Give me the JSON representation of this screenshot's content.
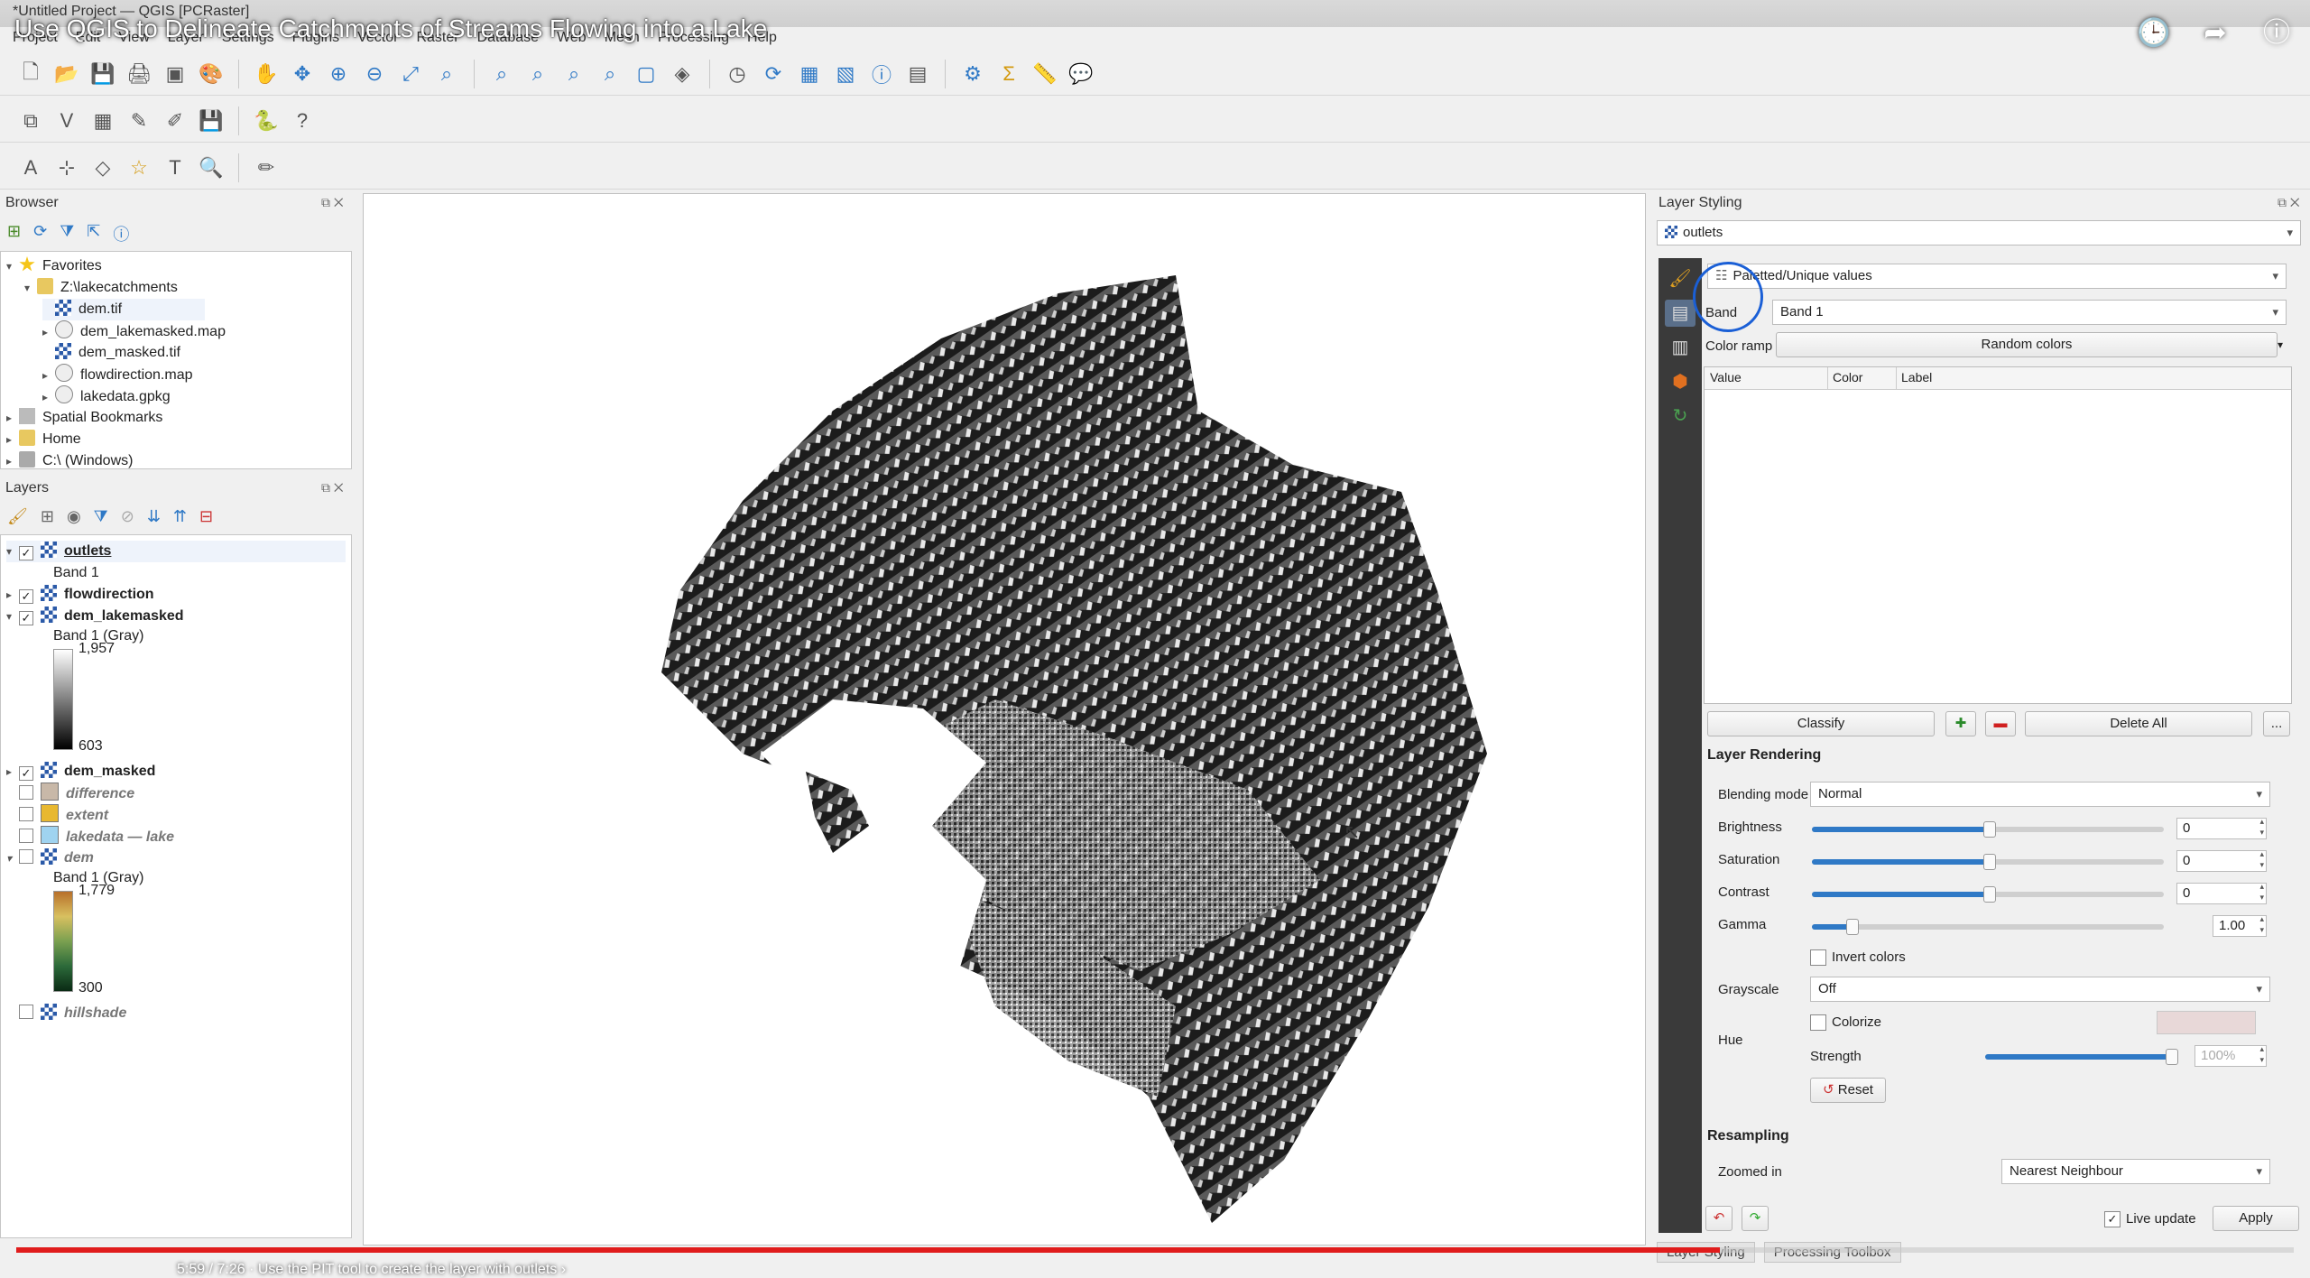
{
  "window": {
    "title": "*Untitled Project — QGIS [PCRaster]",
    "video_title": "Use QGIS to Delineate Catchments of Streams Flowing into a Lake"
  },
  "menu": [
    "Project",
    "Edit",
    "View",
    "Layer",
    "Settings",
    "Plugins",
    "Vector",
    "Raster",
    "Database",
    "Web",
    "Mesh",
    "Processing",
    "Help"
  ],
  "toolbar_icons": {
    "row1": [
      "new-project-icon",
      "open-project-icon",
      "save-project-icon",
      "print-layout-icon",
      "layout-manager-icon",
      "style-manager-icon",
      "pan-icon",
      "pan-to-selection-icon",
      "zoom-in-icon",
      "zoom-out-icon",
      "zoom-full-icon",
      "zoom-selection-icon",
      "zoom-layer-icon",
      "zoom-native-icon",
      "zoom-last-icon",
      "zoom-next-icon",
      "new-map-view-icon",
      "new-3d-view-icon",
      "temporal-icon",
      "refresh-icon",
      "select-icon",
      "deselect-icon",
      "identify-icon",
      "attribute-table-icon",
      "toolbox-gear-icon",
      "sum-icon",
      "measure-icon",
      "annotation-icon"
    ],
    "row2": [
      "add-layer-icon",
      "add-vector-icon",
      "add-raster-icon",
      "digitize-icon",
      "edit-icon",
      "save-edits-icon",
      "python-icon",
      "help-icon"
    ],
    "row3": [
      "label-icon",
      "pin-icon",
      "node-icon",
      "star-icon",
      "text-icon",
      "zoom-tool-icon",
      "pencil-icon"
    ]
  },
  "browser": {
    "title": "Browser",
    "items": [
      {
        "label": "Favorites",
        "icon": "star-icon",
        "indent": 0,
        "expand": "▾"
      },
      {
        "label": "Z:\\lakecatchments",
        "icon": "folder-icon",
        "indent": 1,
        "expand": "▾"
      },
      {
        "label": "dem.tif",
        "icon": "raster-icon",
        "indent": 2,
        "expand": "",
        "selected": true
      },
      {
        "label": "dem_lakemasked.map",
        "icon": "map-icon",
        "indent": 2,
        "expand": "▸"
      },
      {
        "label": "dem_masked.tif",
        "icon": "raster-icon",
        "indent": 2,
        "expand": ""
      },
      {
        "label": "flowdirection.map",
        "icon": "map-icon",
        "indent": 2,
        "expand": "▸"
      },
      {
        "label": "lakedata.gpkg",
        "icon": "database-icon",
        "indent": 2,
        "expand": "▸"
      },
      {
        "label": "Spatial Bookmarks",
        "icon": "bookmark-icon",
        "indent": 0,
        "expand": "▸"
      },
      {
        "label": "Home",
        "icon": "folder-icon",
        "indent": 0,
        "expand": "▸"
      },
      {
        "label": "C:\\ (Windows)",
        "icon": "drive-icon",
        "indent": 0,
        "expand": "▸"
      }
    ]
  },
  "layers": {
    "title": "Layers",
    "outlets": {
      "label": "outlets",
      "band": "Band 1"
    },
    "flowdirection": {
      "label": "flowdirection"
    },
    "dem_lakemasked": {
      "label": "dem_lakemasked",
      "band": "Band 1 (Gray)",
      "max": "1,957",
      "min": "603"
    },
    "dem_masked": {
      "label": "dem_masked"
    },
    "difference": {
      "label": "difference"
    },
    "extent": {
      "label": "extent"
    },
    "lakedata": {
      "label": "lakedata — lake"
    },
    "dem": {
      "label": "dem",
      "band": "Band 1 (Gray)",
      "max": "1,779",
      "min": "300"
    },
    "hillshade": {
      "label": "hillshade"
    }
  },
  "styling": {
    "title": "Layer Styling",
    "layer": "outlets",
    "renderer": "Paletted/Unique values",
    "band_label": "Band",
    "band_value": "Band 1",
    "color_ramp_label": "Color ramp",
    "color_ramp_value": "Random colors",
    "table_headers": [
      "Value",
      "Color",
      "Label"
    ],
    "classify": "Classify",
    "delete_all": "Delete All",
    "more": "...",
    "layer_rendering": "Layer Rendering",
    "blending_label": "Blending mode",
    "blending_value": "Normal",
    "brightness_label": "Brightness",
    "brightness_value": "0",
    "saturation_label": "Saturation",
    "saturation_value": "0",
    "contrast_label": "Contrast",
    "contrast_value": "0",
    "gamma_label": "Gamma",
    "gamma_value": "1.00",
    "invert_label": "Invert colors",
    "grayscale_label": "Grayscale",
    "grayscale_value": "Off",
    "hue_label": "Hue",
    "colorize_label": "Colorize",
    "strength_label": "Strength",
    "strength_value": "100%",
    "reset_label": "Reset",
    "resampling": "Resampling",
    "zoomed_in_label": "Zoomed in",
    "zoomed_in_value": "Nearest Neighbour",
    "live_update_label": "Live update",
    "apply_label": "Apply"
  },
  "bottom_tabs": [
    "Layer Styling",
    "Processing Toolbox"
  ],
  "video": {
    "progress": 0.748,
    "caption": "5:59 / 7:26 · Use the PIT tool to create the layer with outlets ›"
  },
  "colors": {
    "accent": "#2f79c6",
    "progress": "#e01c1c",
    "sidebar": "#3a3a3a"
  }
}
